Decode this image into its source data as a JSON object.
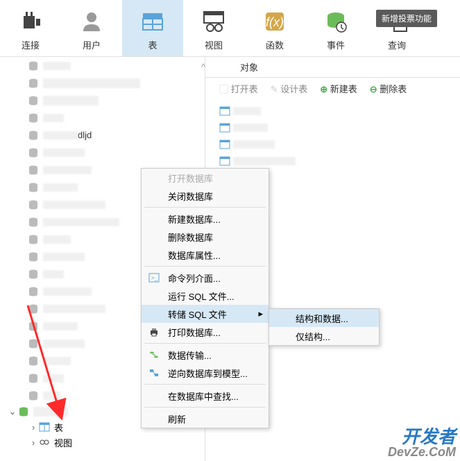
{
  "toolbar": {
    "connect": "连接",
    "user": "用户",
    "table": "表",
    "view": "视图",
    "func": "函数",
    "event": "事件",
    "query": "查询"
  },
  "tooltip": "新增投票功能",
  "sidebar": {
    "items": [
      "",
      "",
      "",
      "",
      "dljd",
      "",
      "",
      "",
      "",
      "",
      "",
      "",
      "",
      "",
      "",
      "",
      "",
      "",
      "",
      "",
      ""
    ]
  },
  "expand": {
    "table": "表",
    "view": "视图"
  },
  "tabs": {
    "objects": "对象"
  },
  "actions": {
    "open": "打开表",
    "design": "设计表",
    "new": "新建表",
    "delete": "删除表"
  },
  "menu": {
    "open_db": "打开数据库",
    "close_db": "关闭数据库",
    "new_db": "新建数据库...",
    "delete_db": "删除数据库",
    "db_props": "数据库属性...",
    "cmdline": "命令列介面...",
    "run_sql": "运行 SQL 文件...",
    "dump_sql": "转储 SQL 文件",
    "print_db": "打印数据库...",
    "data_transfer": "数据传输...",
    "reverse": "逆向数据库到模型...",
    "find_in_db": "在数据库中查找...",
    "refresh": "刷新"
  },
  "submenu": {
    "struct_data": "结构和数据...",
    "struct_only": "仅结构..."
  },
  "watermark": {
    "line1": "开发者",
    "line2": "DevZe.CoM"
  }
}
